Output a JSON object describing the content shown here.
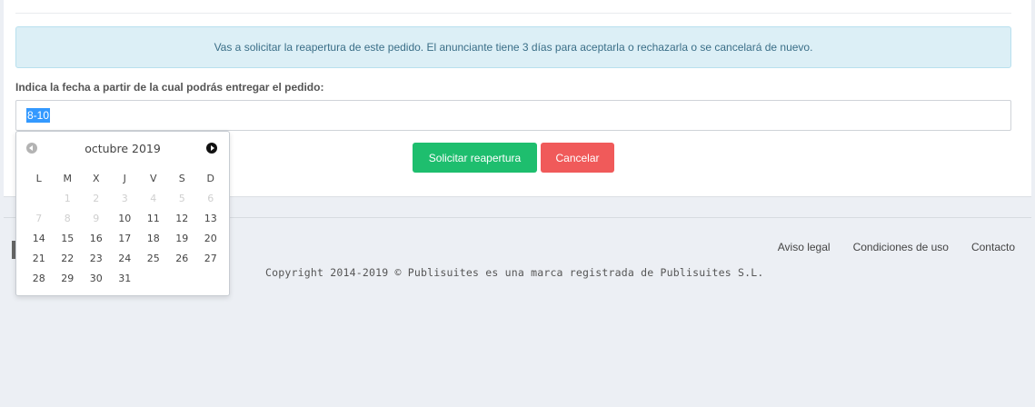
{
  "alert": {
    "message": "Vas a solicitar la reapertura de este pedido. El anunciante tiene 3 días para aceptarla o rechazarla o se cancelará de nuevo."
  },
  "form": {
    "date_label": "Indica la fecha a partir de la cual podrás entregar el pedido:",
    "date_value": "8-10",
    "submit_label": "Solicitar reapertura",
    "cancel_label": "Cancelar"
  },
  "datepicker": {
    "month_title": "octubre 2019",
    "weekdays": [
      "L",
      "M",
      "X",
      "J",
      "V",
      "S",
      "D"
    ],
    "weeks": [
      [
        {
          "d": "1",
          "off": true
        },
        {
          "d": "2",
          "off": true
        },
        {
          "d": "3",
          "off": true
        },
        {
          "d": "4",
          "off": true
        },
        {
          "d": "5",
          "off": true
        },
        {
          "d": "6",
          "off": true
        }
      ],
      [
        {
          "d": "7",
          "off": true
        },
        {
          "d": "8",
          "off": true
        },
        {
          "d": "9",
          "off": true
        },
        {
          "d": "10"
        },
        {
          "d": "11"
        },
        {
          "d": "12"
        },
        {
          "d": "13"
        }
      ],
      [
        {
          "d": "14"
        },
        {
          "d": "15"
        },
        {
          "d": "16"
        },
        {
          "d": "17"
        },
        {
          "d": "18"
        },
        {
          "d": "19"
        },
        {
          "d": "20"
        }
      ],
      [
        {
          "d": "21"
        },
        {
          "d": "22"
        },
        {
          "d": "23"
        },
        {
          "d": "24"
        },
        {
          "d": "25"
        },
        {
          "d": "26"
        },
        {
          "d": "27"
        }
      ],
      [
        {
          "d": "28"
        },
        {
          "d": "29"
        },
        {
          "d": "30"
        },
        {
          "d": "31"
        }
      ]
    ],
    "first_week_offset": 1,
    "icons": {
      "prev": "chevron-left-circle-icon",
      "next": "chevron-right-circle-icon"
    }
  },
  "footer": {
    "links": [
      "Aviso legal",
      "Condiciones de uso",
      "Contacto"
    ],
    "copyright": "Copyright 2014-2019 © Publisuites es una marca registrada de Publisuites S.L."
  },
  "colors": {
    "success": "#1ebe6e",
    "danger": "#f05a5a",
    "info_bg": "#dceff6",
    "selection": "#3399ff"
  }
}
